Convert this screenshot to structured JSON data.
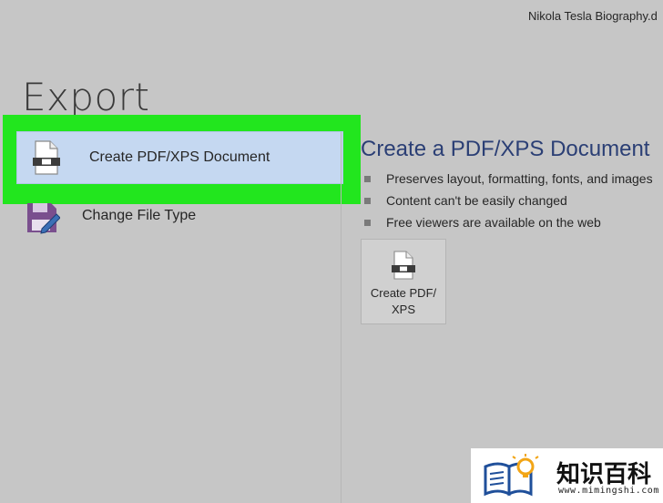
{
  "window": {
    "document_title": "Nikola Tesla Biography.d"
  },
  "page": {
    "heading": "Export"
  },
  "options": [
    {
      "label": "Create PDF/XPS Document",
      "icon": "pdf-document-icon",
      "selected": true
    },
    {
      "label": "Change File Type",
      "icon": "save-edit-icon",
      "selected": false
    }
  ],
  "detail": {
    "heading": "Create a PDF/XPS Document",
    "bullets": [
      "Preserves layout, formatting, fonts, and images",
      "Content can't be easily changed",
      "Free viewers are available on the web"
    ],
    "button_label_line1": "Create PDF/",
    "button_label_line2": "XPS"
  },
  "watermark": {
    "text": "知识百科",
    "url": "www.mimingshi.com"
  },
  "colors": {
    "highlight": "#22e61e",
    "selected_bg": "#c5d8f1",
    "heading_blue": "#2b3f75",
    "background": "#c6c6c6"
  }
}
